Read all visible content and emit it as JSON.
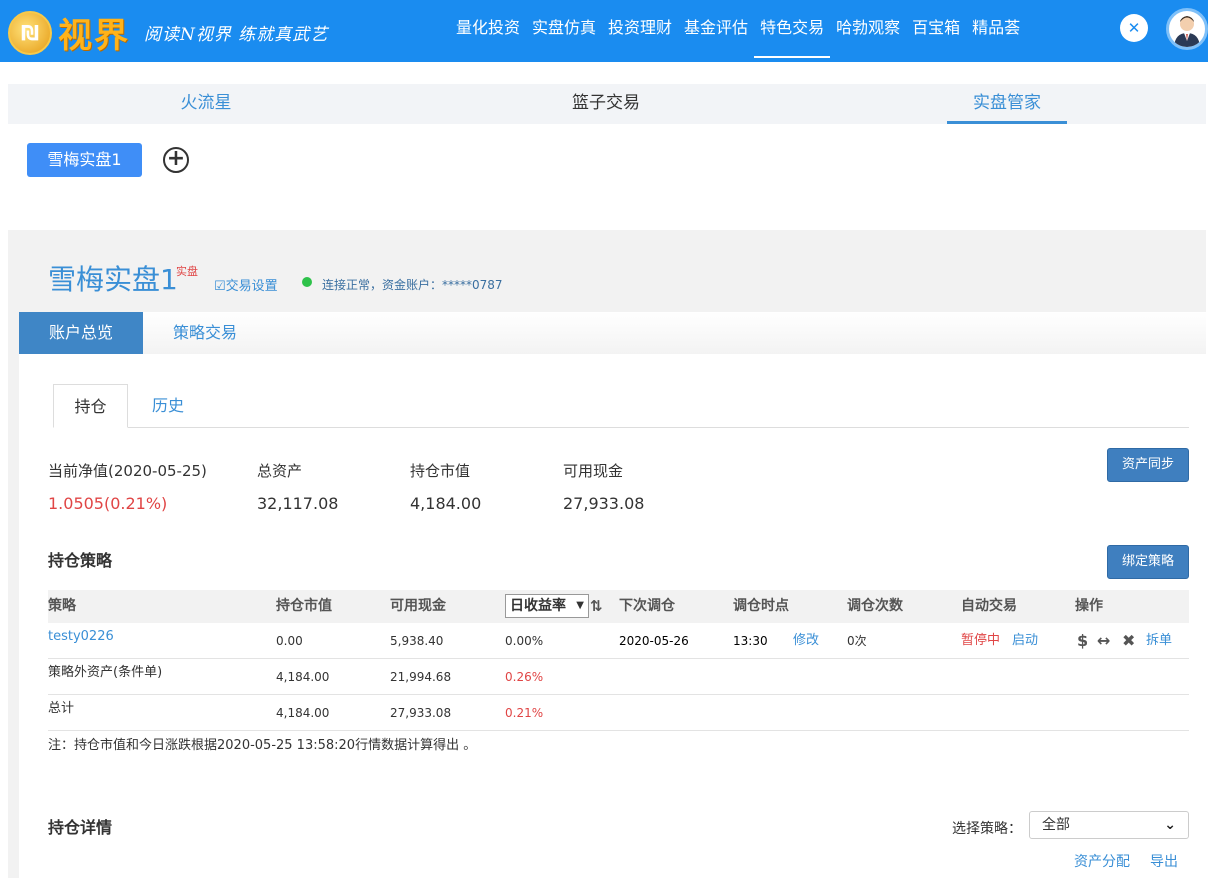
{
  "header": {
    "logo_text": "视界",
    "slogan": "阅读N视界 练就真武艺",
    "nav": [
      "量化投资",
      "实盘仿真",
      "投资理财",
      "基金评估",
      "特色交易",
      "哈勃观察",
      "百宝箱",
      "精品荟"
    ],
    "active_nav": "特色交易"
  },
  "subtabs": [
    "火流星",
    "篮子交易",
    "实盘管家"
  ],
  "account_chip": "雪梅实盘1",
  "account": {
    "name": "雪梅实盘1",
    "tag": "实盘",
    "settings_label": "交易设置",
    "connection_text": "连接正常，资金账户：*****0787"
  },
  "main_tabs": [
    "账户总览",
    "策略交易"
  ],
  "panel_tabs": [
    "持仓",
    "历史"
  ],
  "stats": [
    {
      "label": "当前净值(2020-05-25)",
      "value": "1.0505(0.21%)"
    },
    {
      "label": "总资产",
      "value": "32,117.08"
    },
    {
      "label": "持仓市值",
      "value": "4,184.00"
    },
    {
      "label": "可用现金",
      "value": "27,933.08"
    }
  ],
  "sync_button": "资产同步",
  "bind_button": "绑定策略",
  "holdings_title": "持仓策略",
  "table": {
    "headers": [
      "策略",
      "持仓市值",
      "可用现金",
      "日收益率",
      "下次调仓",
      "调仓时点",
      "调仓次数",
      "自动交易",
      "操作"
    ],
    "rows": [
      {
        "name": "testy0226",
        "market": "0.00",
        "cash": "5,938.40",
        "ret": "0.00%",
        "next": "2020-05-26",
        "time": "13:30",
        "edit": "修改",
        "count": "0次",
        "status": "暂停中",
        "start": "启动",
        "split": "拆单"
      },
      {
        "name": "策略外资产(条件单)",
        "market": "4,184.00",
        "cash": "21,994.68",
        "ret": "0.26%"
      },
      {
        "name": "总计",
        "market": "4,184.00",
        "cash": "27,933.08",
        "ret": "0.21%"
      }
    ]
  },
  "note": "注：持仓市值和今日涨跌根据2020-05-25 13:58:20行情数据计算得出 。",
  "details_title": "持仓详情",
  "filter": {
    "label": "选择策略：",
    "value": "全部"
  },
  "footer_links": [
    "资产分配",
    "导出"
  ]
}
